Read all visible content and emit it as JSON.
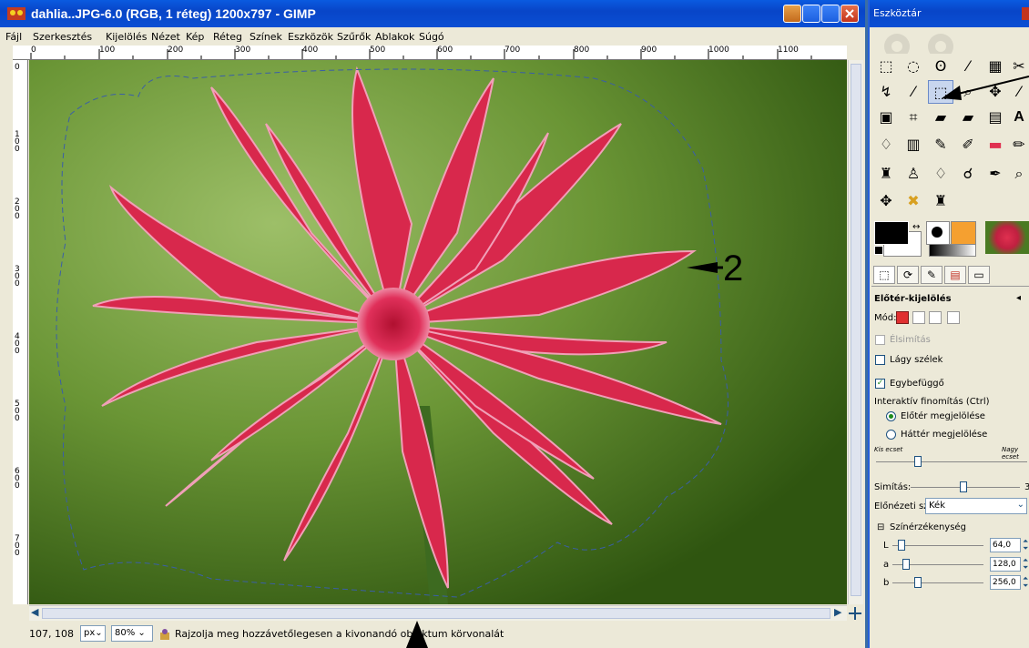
{
  "window": {
    "title": "dahlia..JPG-6.0 (RGB, 1 réteg) 1200x797 - GIMP"
  },
  "menu": [
    "Fájl",
    "Szerkesztés",
    "Kijelölés",
    "Nézet",
    "Kép",
    "Réteg",
    "Színek",
    "Eszközök",
    "Szűrők",
    "Ablakok",
    "Súgó"
  ],
  "ruler": {
    "h_ticks": [
      "0",
      "100",
      "200",
      "300",
      "400",
      "500",
      "600",
      "700",
      "800",
      "900",
      "1000",
      "1100"
    ],
    "v_ticks": [
      "0",
      "100",
      "200",
      "300",
      "400",
      "500",
      "600",
      "700"
    ]
  },
  "annotation": {
    "marker_label": "2"
  },
  "status": {
    "coords": "107, 108",
    "unit": "px",
    "zoom": "80%",
    "message": "Rajzolja meg hozzávetőlegesen a kivonandó objektum körvonalát"
  },
  "toolbox": {
    "title": "Eszköztár",
    "tool_options": {
      "title": "Előtér-kijelölés",
      "mode_label": "Mód:",
      "antialias_label": "Élsimítás",
      "feather_label": "Lágy szélek",
      "contiguous_label": "Egybefüggő",
      "interactive_label": "Interaktív finomítás (Ctrl)",
      "mark_fg_label": "Előtér megjelölése",
      "mark_bg_label": "Háttér megjelölése",
      "small_brush_label": "Kis ecset",
      "large_brush_label": "Nagy ecset",
      "smoothing_label": "Simítás:",
      "smoothing_value": "3",
      "preview_color_label": "Előnézeti szín:",
      "preview_color_value": "Kék",
      "sensitivity_label": "Színérzékenység",
      "L_label": "L",
      "L_value": "64,0",
      "a_label": "a",
      "a_value": "128,0",
      "b_label": "b",
      "b_value": "256,0"
    }
  },
  "colors": {
    "titlebar": "#0a5be0",
    "fg": "#000000",
    "bg": "#ffffff"
  }
}
